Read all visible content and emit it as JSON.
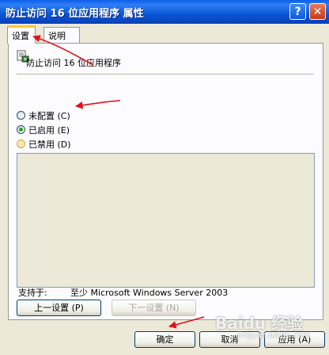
{
  "window": {
    "title": "防止访问 16 位应用程序 属性",
    "help_glyph": "?",
    "close_glyph": "✕"
  },
  "tabs": [
    {
      "label": "设置",
      "active": true
    },
    {
      "label": "说明",
      "active": false
    }
  ],
  "policy": {
    "icon": "policy-setting-icon",
    "name": "防止访问 16 位应用程序"
  },
  "options": [
    {
      "label": "未配置 (C)",
      "selected": false
    },
    {
      "label": "已启用 (E)",
      "selected": true
    },
    {
      "label": "已禁用 (D)",
      "selected": false
    }
  ],
  "support": {
    "label": "支持于:",
    "value": "至少 Microsoft Windows Server 2003"
  },
  "nav_buttons": {
    "prev": "上一设置 (P)",
    "next": "下一设置 (N)"
  },
  "dialog_buttons": {
    "ok": "确定",
    "cancel": "取消",
    "apply": "应用 (A)"
  },
  "watermark": {
    "brand": "Baidu 经验",
    "url": "jingyan.baidu.com"
  },
  "colors": {
    "annotation_arrow": "#E0101A",
    "title_bar": "#0A5FE8"
  }
}
